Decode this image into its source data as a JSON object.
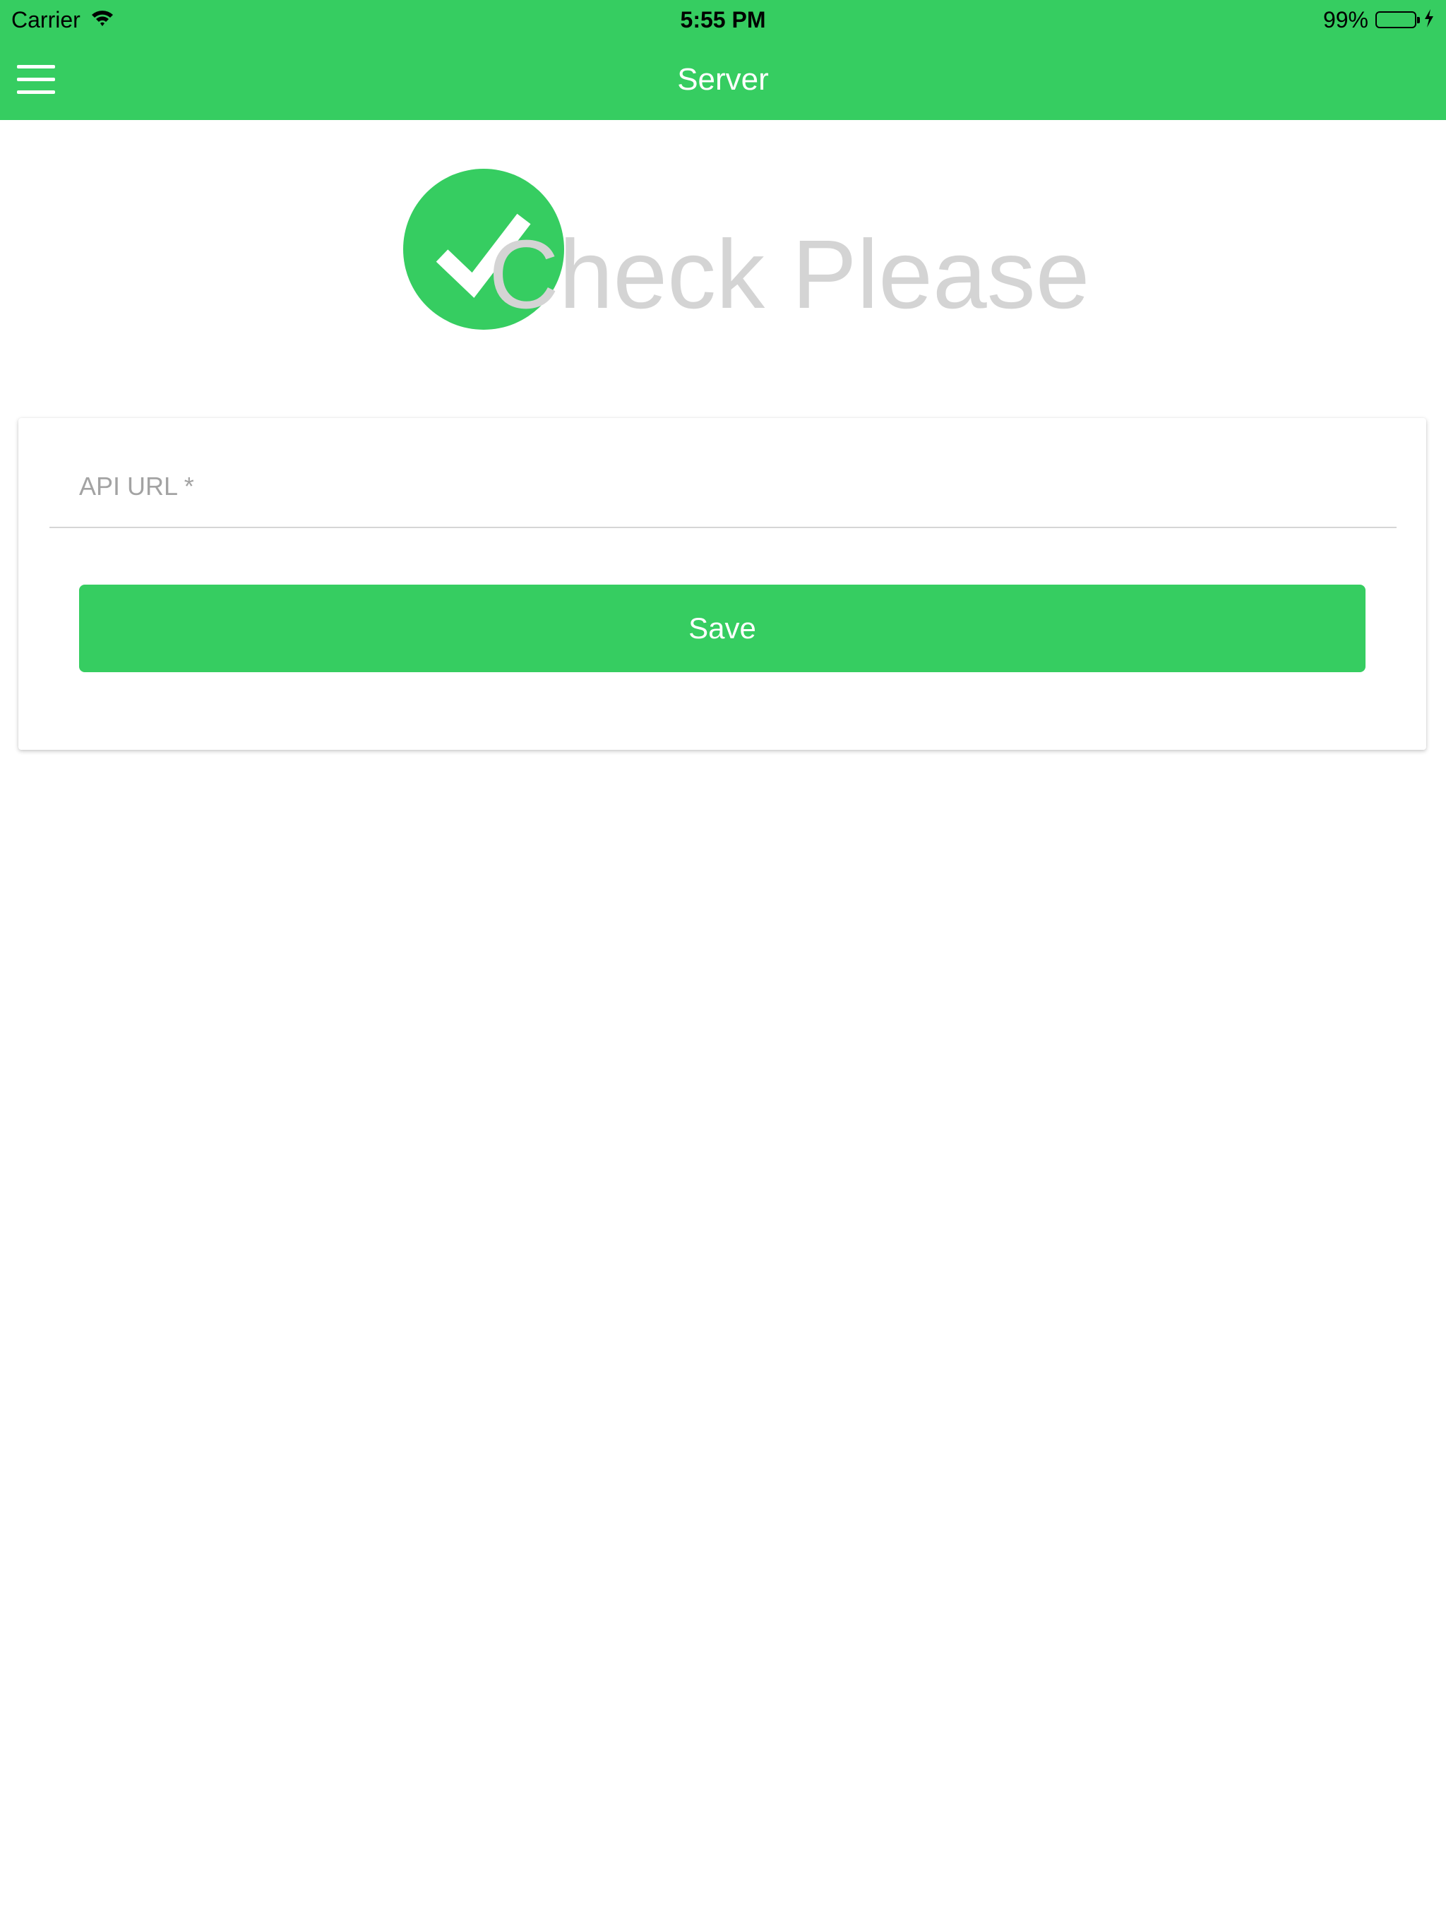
{
  "status_bar": {
    "carrier": "Carrier",
    "time": "5:55 PM",
    "battery_percent_label": "99%",
    "battery_level": 0.99,
    "icons": [
      "wifi-icon",
      "battery-icon",
      "charging-bolt-icon"
    ]
  },
  "nav": {
    "title": "Server",
    "menu_icon": "hamburger-menu-icon"
  },
  "logo": {
    "text": "Check Please",
    "icon": "checkmark-circle-icon"
  },
  "form": {
    "api_url_placeholder": "API URL *",
    "api_url_value": "",
    "save_label": "Save"
  },
  "colors": {
    "brand_green": "#36cd61",
    "logo_text_gray": "#d4d4d4",
    "placeholder_gray": "#a3a3a3"
  }
}
